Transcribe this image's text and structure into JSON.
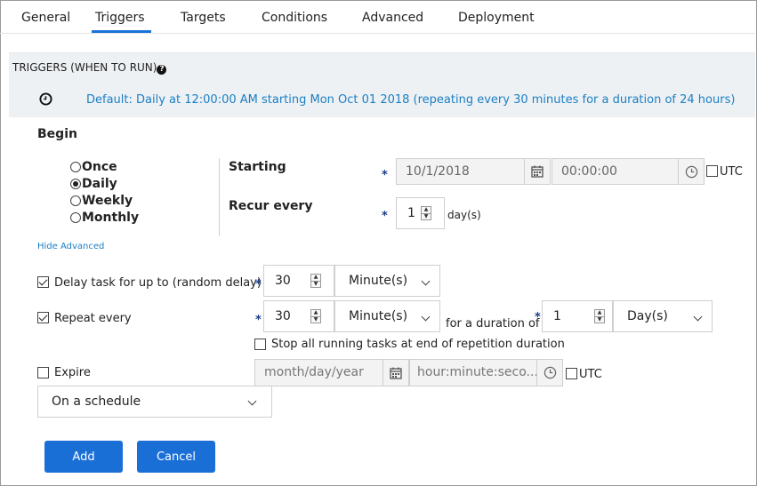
{
  "tabs": [
    {
      "label": "General",
      "active": false
    },
    {
      "label": "Triggers",
      "active": true
    },
    {
      "label": "Targets",
      "active": false
    },
    {
      "label": "Conditions",
      "active": false
    },
    {
      "label": "Advanced",
      "active": false
    },
    {
      "label": "Deployment",
      "active": false
    }
  ],
  "section": {
    "title": "TRIGGERS (WHEN TO RUN)",
    "help_icon": "?",
    "summary": "Default: Daily at 12:00:00 AM starting Mon Oct 01 2018 (repeating every 30 minutes for a duration of 24 hours)"
  },
  "begin": {
    "label": "Begin",
    "options": [
      "Once",
      "Daily",
      "Weekly",
      "Monthly"
    ],
    "selected": "Daily"
  },
  "starting": {
    "label": "Starting",
    "required_mark": "*",
    "date": "10/1/2018",
    "time": "00:00:00",
    "utc_label": "UTC",
    "utc_checked": false
  },
  "recur": {
    "label": "Recur every",
    "required_mark": "*",
    "value": "1",
    "unit": "day(s)"
  },
  "hide_advanced": "Hide Advanced",
  "delay": {
    "checked": true,
    "label": "Delay task for up to (random delay)",
    "required_mark": "*",
    "value": "30",
    "unit": "Minute(s)"
  },
  "repeat": {
    "checked": true,
    "label": "Repeat every",
    "required_mark": "*",
    "value": "30",
    "unit": "Minute(s)",
    "duration_label": "for a duration of",
    "duration_required_mark": "*",
    "duration_value": "1",
    "duration_unit": "Day(s)"
  },
  "stop_all": {
    "checked": false,
    "label": "Stop all running tasks at end of repetition duration"
  },
  "expire": {
    "checked": false,
    "label": "Expire",
    "date_placeholder": "month/day/year",
    "time_placeholder": "hour:minute:seco...",
    "utc_label": "UTC",
    "utc_checked": false
  },
  "schedule_select": {
    "value": "On a schedule"
  },
  "buttons": {
    "add": "Add",
    "cancel": "Cancel"
  },
  "colors": {
    "accent": "#1a6fd6",
    "link": "#1a7fc4",
    "tab_underline": "#1a73d9",
    "section_bg": "#eef1f4"
  },
  "icons": {
    "clock": "clock-icon",
    "calendar": "calendar-icon",
    "help": "help-icon",
    "chevron": "chevron-down-icon"
  }
}
